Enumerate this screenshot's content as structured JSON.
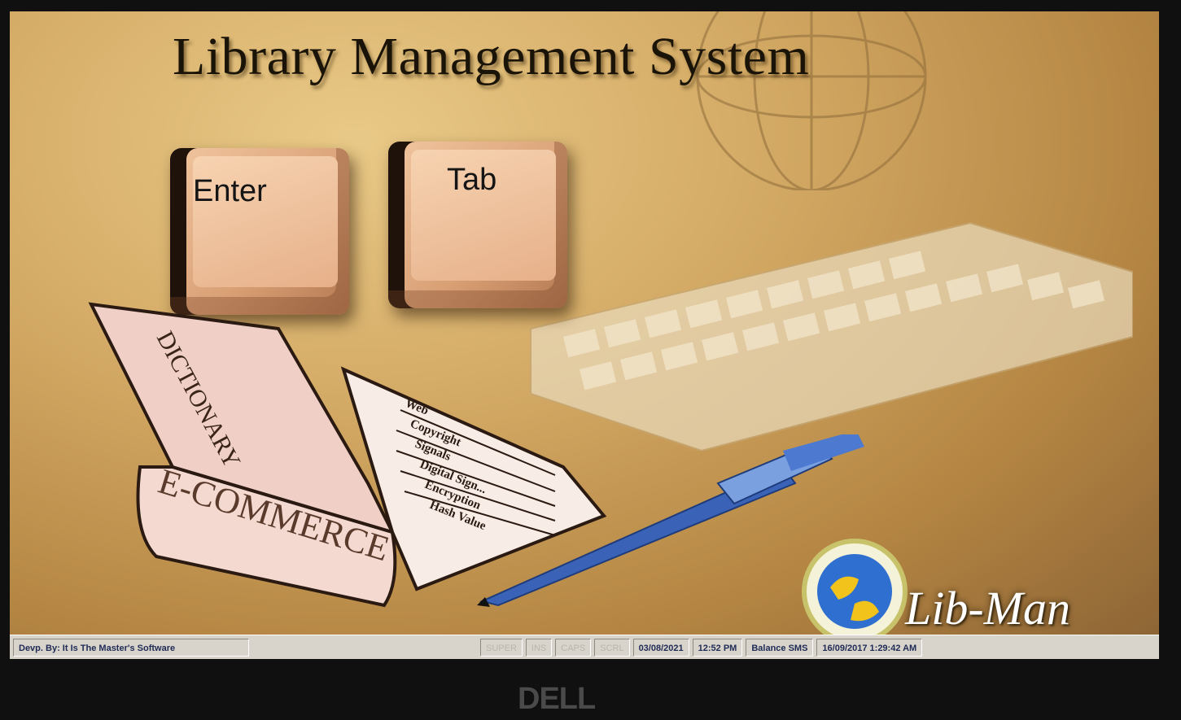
{
  "window": {
    "title": "Library Management System"
  },
  "keys": {
    "enter_label": "Enter",
    "tab_label": "Tab"
  },
  "book": {
    "spine_text": "E-COMMERCE",
    "cover_text": "DICTIONARY",
    "page_lines": [
      "Web",
      "Copyright",
      "Signals",
      "Digital Sign...",
      "Encryption",
      "Hash Value"
    ]
  },
  "logo": {
    "name": "Lib-Man"
  },
  "statusbar": {
    "developer": "Devp. By: It Is The Master's Software",
    "indicators": [
      "SUPER",
      "INS",
      "CAPS",
      "SCRL"
    ],
    "date": "03/08/2021",
    "time": "12:52 PM",
    "balance": "Balance SMS",
    "datetime": "16/09/2017 1:29:42 AM"
  },
  "monitor": {
    "brand": "DELL"
  },
  "colors": {
    "background": "#d4ab66",
    "key": "#e6b08a",
    "statusbar": "#d8d4cc",
    "pen": "#3a63b8"
  }
}
